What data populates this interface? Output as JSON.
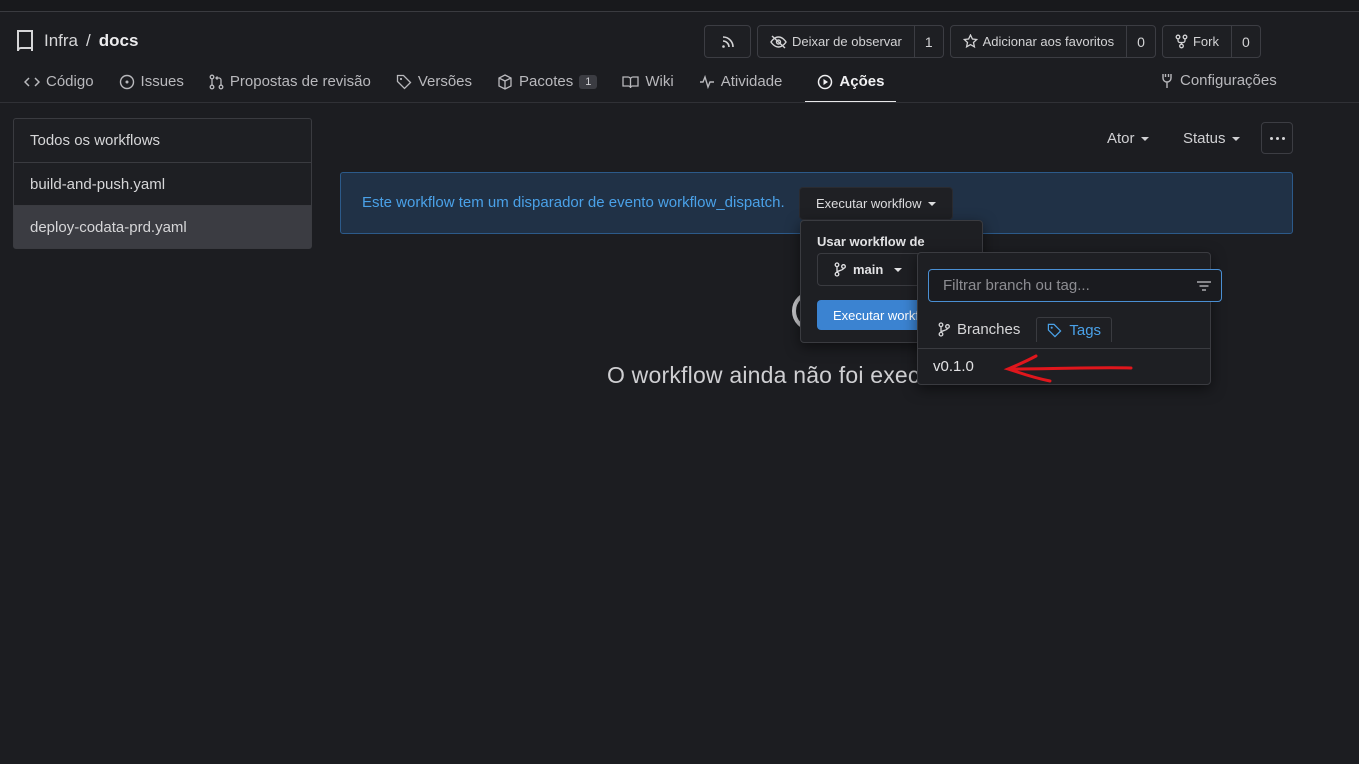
{
  "repo": {
    "owner": "Infra",
    "separator": "/",
    "name": "docs"
  },
  "header_actions": {
    "unwatch_label": "Deixar de observar",
    "watch_count": "1",
    "star_label": "Adicionar aos favoritos",
    "star_count": "0",
    "fork_label": "Fork",
    "fork_count": "0"
  },
  "tabs": [
    {
      "label": "Código",
      "icon": "code-icon"
    },
    {
      "label": "Issues",
      "icon": "issue-icon"
    },
    {
      "label": "Propostas de revisão",
      "icon": "pull-request-icon"
    },
    {
      "label": "Versões",
      "icon": "tag-icon"
    },
    {
      "label": "Pacotes",
      "icon": "package-icon",
      "badge": "1"
    },
    {
      "label": "Wiki",
      "icon": "book-icon"
    },
    {
      "label": "Atividade",
      "icon": "pulse-icon"
    },
    {
      "label": "Ações",
      "icon": "play-icon",
      "active": true
    }
  ],
  "settings_tab": "Configurações",
  "sidebar": {
    "items": [
      {
        "label": "Todos os workflows"
      },
      {
        "label": "build-and-push.yaml"
      },
      {
        "label": "deploy-codata-prd.yaml",
        "selected": true
      }
    ]
  },
  "filters": {
    "actor": "Ator",
    "status": "Status"
  },
  "banner": {
    "text": "Este workflow tem um disparador de evento workflow_dispatch.",
    "run_button": "Executar workflow"
  },
  "run_popup": {
    "label": "Usar workflow de",
    "branch": "main",
    "submit": "Executar workflow"
  },
  "branch_dropdown": {
    "filter_placeholder": "Filtrar branch ou tag...",
    "tab_branches": "Branches",
    "tab_tags": "Tags",
    "items": [
      "v0.1.0"
    ]
  },
  "empty_state": {
    "text": "O workflow ainda não foi executado."
  },
  "colors": {
    "accent": "#4aa1e8",
    "primary_button": "#3b83d1",
    "annotation": "#e0161c"
  }
}
